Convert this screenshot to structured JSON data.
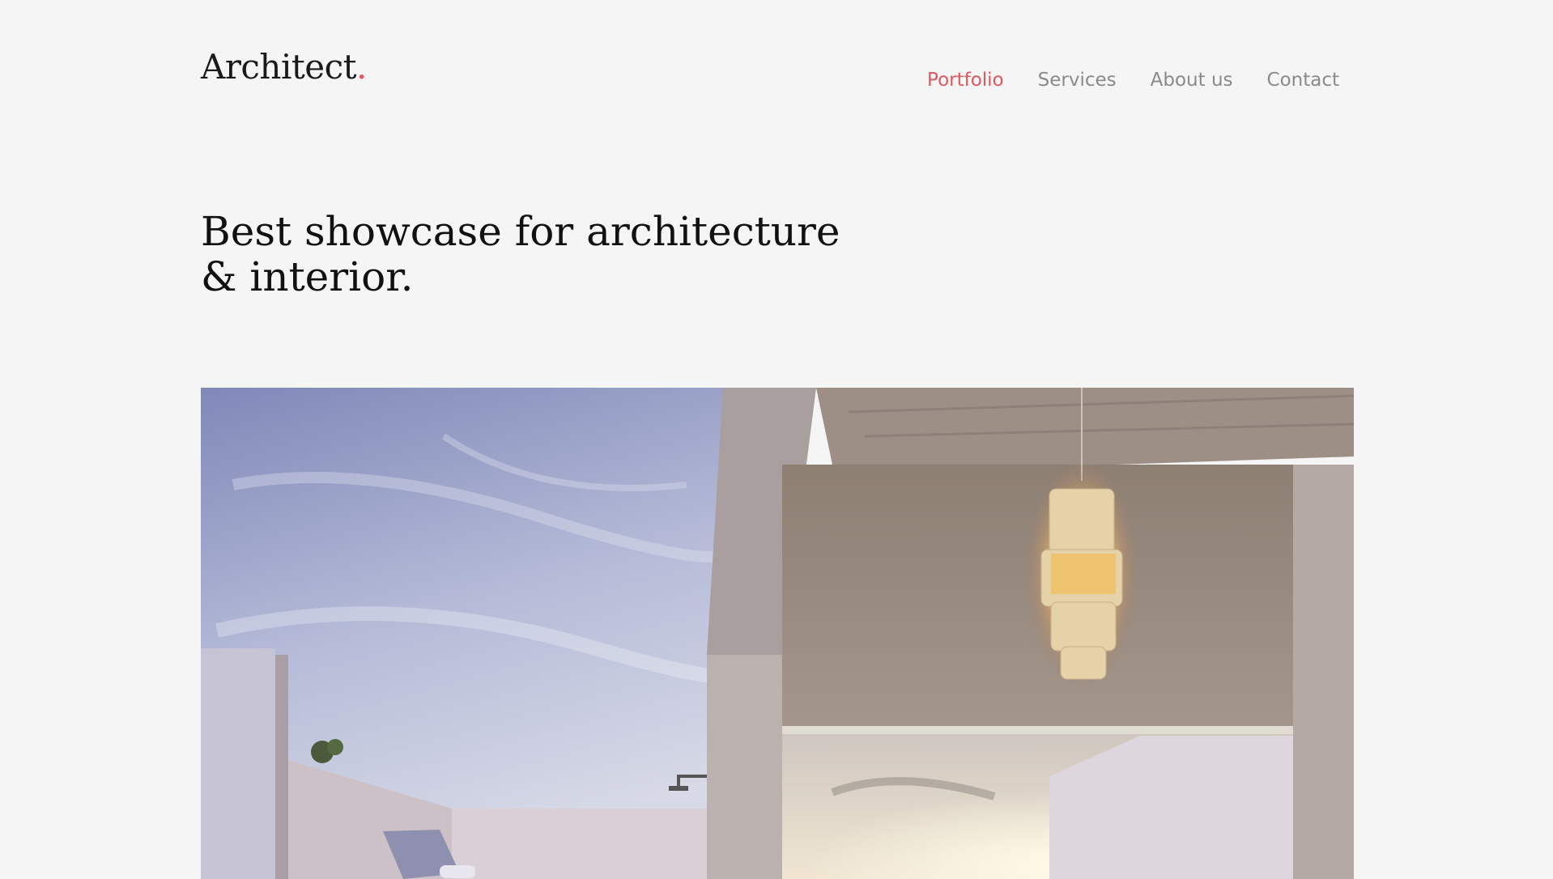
{
  "brand": {
    "name": "Architect",
    "dot": ".",
    "accent": "#e0585c"
  },
  "nav": {
    "items": [
      {
        "label": "Portfolio",
        "active": true
      },
      {
        "label": "Services",
        "active": false
      },
      {
        "label": "About us",
        "active": false
      },
      {
        "label": "Contact",
        "active": false
      }
    ]
  },
  "hero": {
    "headline": "Best showcase for architecture & interior."
  }
}
